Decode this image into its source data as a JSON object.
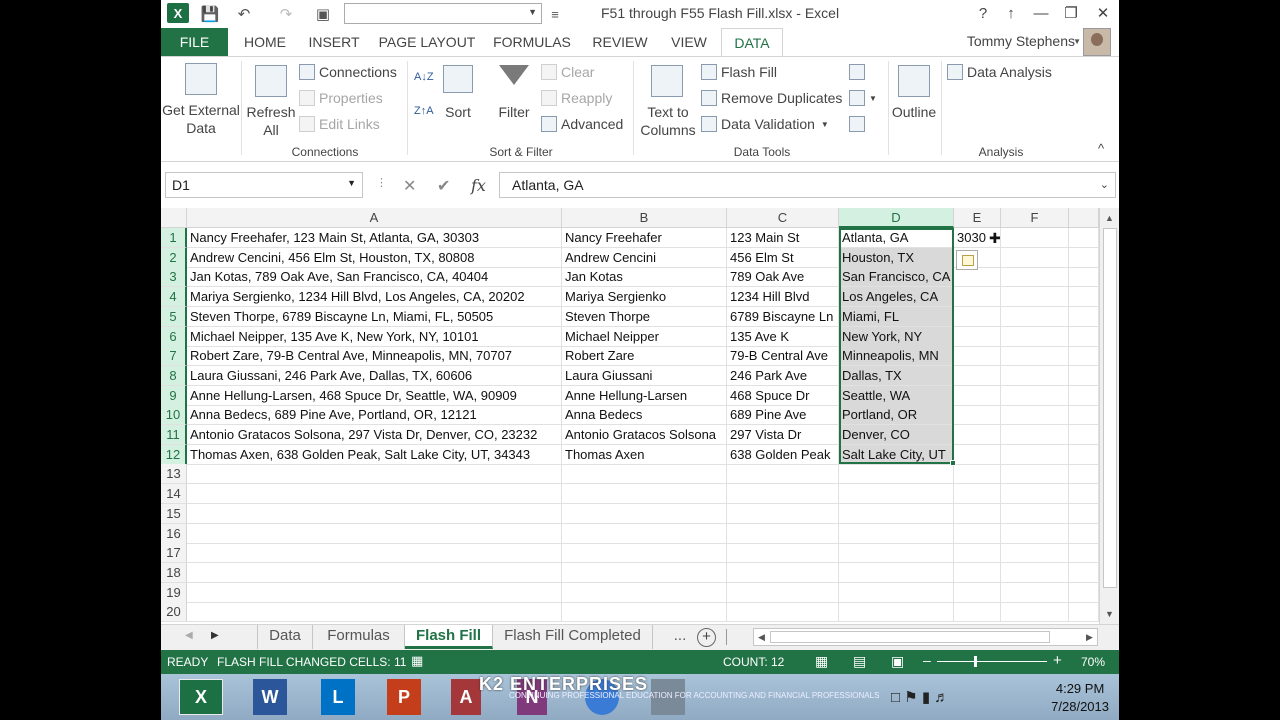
{
  "window": {
    "title": "F51 through F55 Flash Fill.xlsx - Excel",
    "help": "?",
    "controls": [
      "↑",
      "—",
      "❐",
      "✕"
    ]
  },
  "quick_access": {
    "undo": "↶",
    "redo": "↷",
    "camera": "▣",
    "more": "≡"
  },
  "tabs": [
    "FILE",
    "HOME",
    "INSERT",
    "PAGE LAYOUT",
    "FORMULAS",
    "REVIEW",
    "VIEW",
    "DATA"
  ],
  "active_tab": "DATA",
  "user": "Tommy Stephens",
  "ribbon": {
    "get_external": "Get External Data",
    "refresh_all": "Refresh All",
    "connections": "Connections",
    "properties": "Properties",
    "edit_links": "Edit Links",
    "group_connections": "Connections",
    "sort_az": "A↓Z",
    "sort": "Sort",
    "filter": "Filter",
    "clear": "Clear",
    "reapply": "Reapply",
    "advanced": "Advanced",
    "group_sort_filter": "Sort & Filter",
    "text_to_columns": "Text to Columns",
    "flash_fill": "Flash Fill",
    "remove_duplicates": "Remove Duplicates",
    "data_validation": "Data Validation",
    "group_data_tools": "Data Tools",
    "outline": "Outline",
    "data_analysis": "Data Analysis",
    "group_analysis": "Analysis",
    "collapse": "^"
  },
  "formula_bar": {
    "name_box": "D1",
    "cancel": "✕",
    "enter": "✔",
    "fx": "fx",
    "value": "Atlanta, GA"
  },
  "columns": [
    "A",
    "B",
    "C",
    "D",
    "E",
    "F"
  ],
  "rows": [
    [
      "Nancy Freehafer, 123 Main St, Atlanta, GA, 30303",
      "Nancy Freehafer",
      "123 Main St",
      "Atlanta, GA",
      "3030"
    ],
    [
      "Andrew Cencini, 456 Elm St, Houston, TX, 80808",
      "Andrew Cencini",
      "456 Elm St",
      "Houston, TX",
      ""
    ],
    [
      "Jan Kotas, 789 Oak Ave, San Francisco, CA, 40404",
      "Jan Kotas",
      "789 Oak Ave",
      "San Francisco, CA",
      ""
    ],
    [
      "Mariya Sergienko, 1234 Hill Blvd, Los Angeles, CA, 20202",
      "Mariya Sergienko",
      "1234 Hill Blvd",
      "Los Angeles, CA",
      ""
    ],
    [
      "Steven Thorpe, 6789 Biscayne Ln, Miami, FL, 50505",
      "Steven Thorpe",
      "6789 Biscayne Ln",
      "Miami, FL",
      ""
    ],
    [
      "Michael Neipper, 135 Ave K, New York, NY, 10101",
      "Michael Neipper",
      "135 Ave K",
      "New York, NY",
      ""
    ],
    [
      "Robert Zare, 79-B Central Ave, Minneapolis, MN, 70707",
      "Robert Zare",
      "79-B Central Ave",
      "Minneapolis, MN",
      ""
    ],
    [
      "Laura Giussani, 246 Park Ave, Dallas, TX, 60606",
      "Laura Giussani",
      "246 Park Ave",
      "Dallas, TX",
      ""
    ],
    [
      "Anne Hellung-Larsen, 468 Spuce Dr, Seattle, WA, 90909",
      "Anne Hellung-Larsen",
      "468 Spuce Dr",
      "Seattle, WA",
      ""
    ],
    [
      "Anna Bedecs, 689 Pine Ave, Portland, OR, 12121",
      "Anna Bedecs",
      "689 Pine Ave",
      "Portland, OR",
      ""
    ],
    [
      "Antonio Gratacos Solsona, 297 Vista Dr, Denver, CO, 23232",
      "Antonio Gratacos Solsona",
      "297 Vista Dr",
      "Denver, CO",
      ""
    ],
    [
      "Thomas Axen, 638 Golden Peak, Salt Lake City, UT, 34343",
      "Thomas Axen",
      "638 Golden Peak",
      "Salt Lake City, UT",
      ""
    ]
  ],
  "row_numbers": [
    "1",
    "2",
    "3",
    "4",
    "5",
    "6",
    "7",
    "8",
    "9",
    "10",
    "11",
    "12",
    "13",
    "14",
    "15",
    "16",
    "17",
    "18",
    "19",
    "20"
  ],
  "sheets": [
    "Data",
    "Formulas",
    "Flash Fill",
    "Flash Fill Completed",
    "..."
  ],
  "active_sheet": "Flash Fill",
  "status": {
    "mode": "READY",
    "message": "FLASH FILL CHANGED CELLS: 11",
    "count": "COUNT: 12",
    "zoom": "70%"
  },
  "taskbar": {
    "apps": [
      "X",
      "W",
      "L",
      "P",
      "A",
      "N"
    ],
    "brand": "K2 ENTERPRISES",
    "brand_sub": "CONTINUING PROFESSIONAL EDUCATION FOR ACCOUNTING AND FINANCIAL PROFESSIONALS",
    "time": "4:29 PM",
    "date": "7/28/2013"
  },
  "colors": {
    "accent": "#217346",
    "selected_range": "#d9d9d9"
  }
}
